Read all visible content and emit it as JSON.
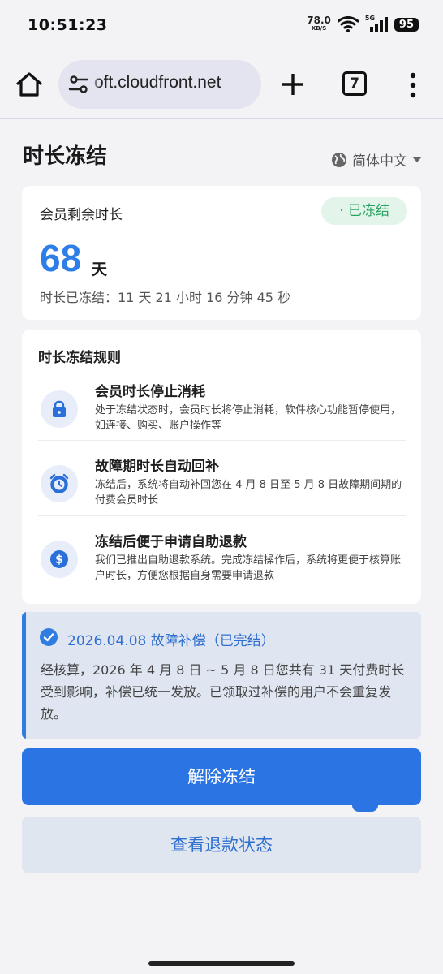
{
  "status_bar": {
    "time": "10:51:23",
    "net_speed": "78.0",
    "net_unit": "KB/S",
    "network": "5G",
    "battery": "95"
  },
  "browser": {
    "url": "oft.cloudfront.net",
    "tab_count": "7"
  },
  "page": {
    "title": "时长冻结",
    "language": "简体中文"
  },
  "membership": {
    "label": "会员剩余时长",
    "status_badge": "· 已冻结",
    "days": "68",
    "days_unit": "天",
    "frozen_duration": "时长已冻结：11 天 21 小时 16 分钟 45 秒"
  },
  "rules": {
    "title": "时长冻结规则",
    "items": [
      {
        "icon": "lock-icon",
        "title": "会员时长停止消耗",
        "desc": "处于冻结状态时，会员时长将停止消耗，软件核心功能暂停使用，如连接、购买、账户操作等"
      },
      {
        "icon": "alarm-clock-icon",
        "title": "故障期时长自动回补",
        "desc": "冻结后，系统将自动补回您在 4 月 8 日至 5 月 8 日故障期间期的付费会员时长"
      },
      {
        "icon": "dollar-coin-icon",
        "title": "冻结后便于申请自助退款",
        "desc": "我们已推出自助退款系统。完成冻结操作后，系统将更便于核算账户时长，方便您根据自身需要申请退款"
      }
    ]
  },
  "notice": {
    "title": "2026.04.08 故障补偿（已完结）",
    "body": "经核算，2026 年 4 月 8 日 ~ 5 月 8 日您共有 31 天付费时长受到影响，补偿已统一发放。已领取过补偿的用户不会重复发放。"
  },
  "actions": {
    "unfreeze": "解除冻结",
    "refund_status": "查看退款状态"
  },
  "colors": {
    "accent": "#2b74e4",
    "frozen_green": "#2aa263",
    "notice_bg": "#dfe6f1"
  }
}
